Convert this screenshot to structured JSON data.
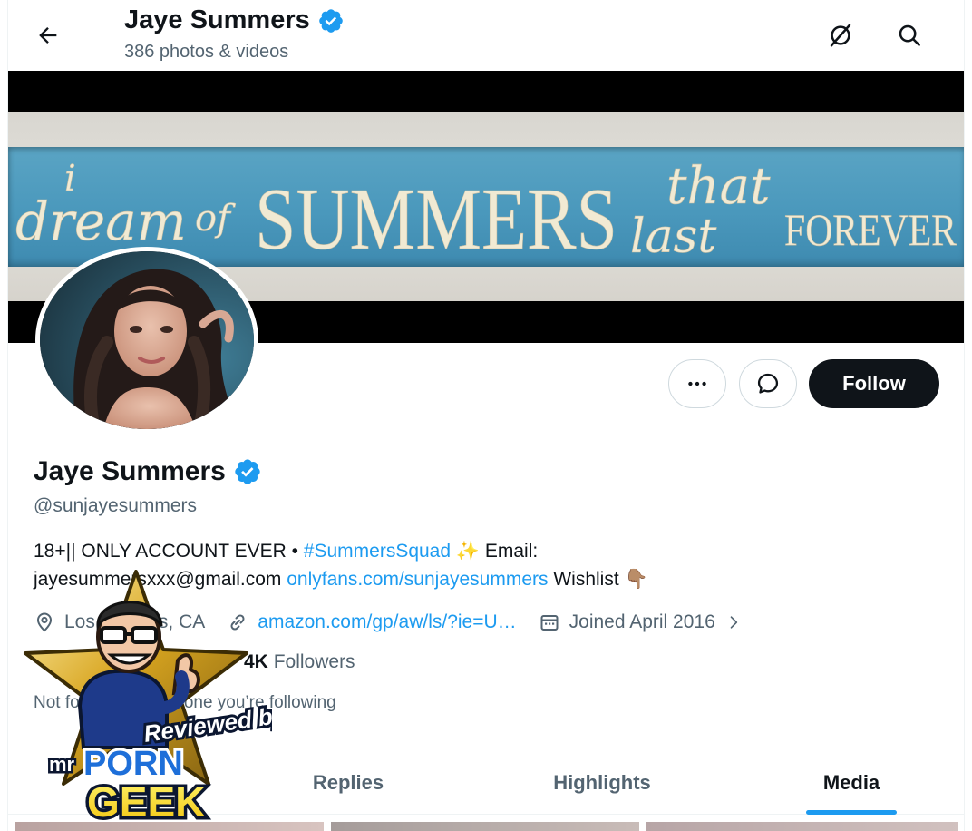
{
  "header": {
    "title": "Jaye Summers",
    "subtitle": "386 photos & videos"
  },
  "banner": {
    "line_i": "i",
    "dream": "dream",
    "of": "of",
    "summers": "SUMMERS",
    "that": "that",
    "last": "last",
    "forever": "FOREVER"
  },
  "actions": {
    "follow_label": "Follow"
  },
  "profile": {
    "name": "Jaye Summers",
    "handle": "@sunjayesummers",
    "bio": {
      "part1": "18+|| ONLY ACCOUNT EVER • ",
      "hashtag": "#SummersSquad",
      "sparkle": "✨",
      "part2": " Email:",
      "email": "jayesummersxxx@gmail.com ",
      "onlyfans": "onlyfans.com/sunjayesummers",
      "wishlist": " Wishlist ",
      "finger": "👇🏽"
    },
    "location": "Los Angeles, CA",
    "website": "amazon.com/gp/aw/ls/?ie=U…",
    "joined": "Joined April 2016",
    "followers_count": "4K",
    "followers_label": "Followers",
    "followed_note": "Not followed by anyone you’re following"
  },
  "tabs": [
    {
      "label": "Replies"
    },
    {
      "label": "Highlights"
    },
    {
      "label": "Media"
    }
  ],
  "watermark": {
    "brand_mr": "mr",
    "brand_porn": "PORN",
    "brand_geek": "GEEK",
    "reviewed_by": "Reviewed by"
  },
  "colors": {
    "accent": "#1d9bf0",
    "text": "#0f1419",
    "muted": "#536471",
    "verified": "#1d9bf0"
  }
}
